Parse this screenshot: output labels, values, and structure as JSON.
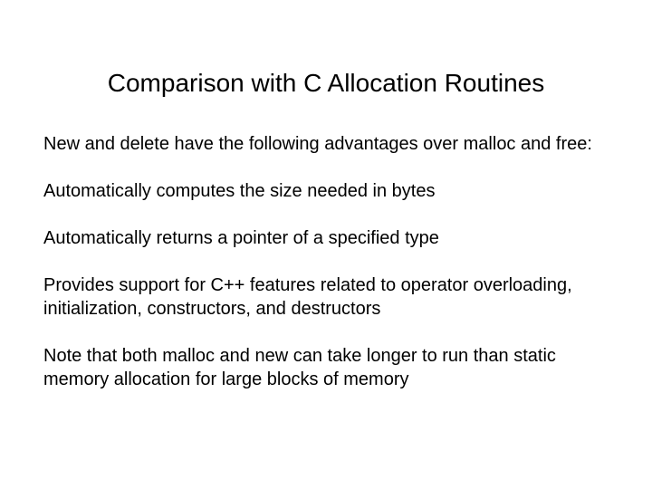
{
  "slide": {
    "title": "Comparison with C Allocation Routines",
    "paragraphs": [
      "New and delete have the following advantages over malloc and free:",
      "Automatically computes the size needed in bytes",
      "Automatically returns a pointer of a specified type",
      "Provides support for C++ features related to operator overloading, initialization, constructors, and destructors",
      "Note that both malloc and new can take longer to run than static memory allocation for large blocks of memory"
    ]
  }
}
